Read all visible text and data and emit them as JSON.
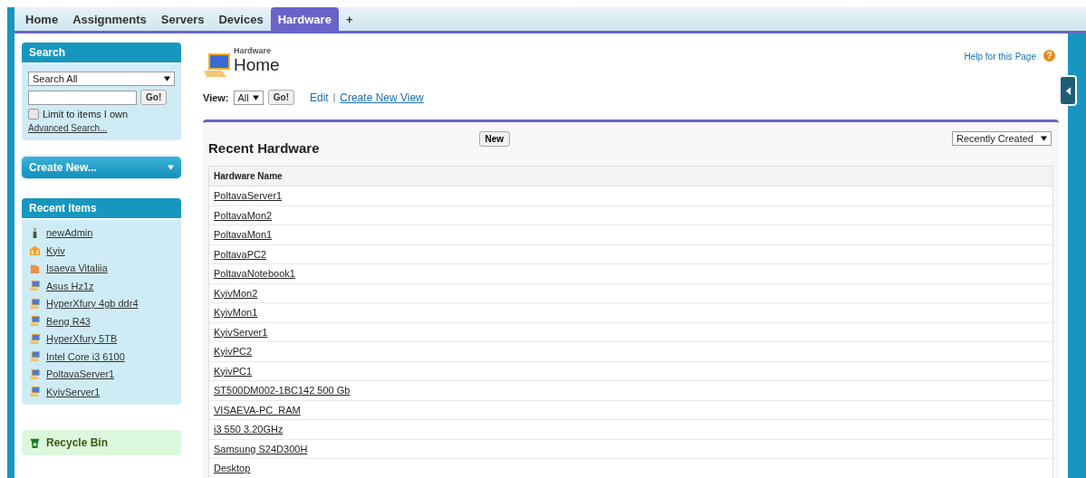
{
  "tabs": [
    {
      "label": "Home",
      "selected": false
    },
    {
      "label": "Assignments",
      "selected": false
    },
    {
      "label": "Servers",
      "selected": false
    },
    {
      "label": "Devices",
      "selected": false
    },
    {
      "label": "Hardware",
      "selected": true
    },
    {
      "label": "+",
      "selected": false
    }
  ],
  "sidebar": {
    "search": {
      "title": "Search",
      "scope": "Search All",
      "button": "Go!",
      "limit_label": "Limit to items I own",
      "limit_checked": false,
      "advanced": "Advanced Search..."
    },
    "create_new": "Create New...",
    "recent_items": {
      "title": "Recent Items",
      "items": [
        {
          "label": "newAdmin",
          "kind": "user"
        },
        {
          "label": "Kyiv",
          "kind": "building"
        },
        {
          "label": "Isaeva Vitaliia",
          "kind": "folder"
        },
        {
          "label": "Asus Hz1z",
          "kind": "computer"
        },
        {
          "label": "HyperXfury 4gb ddr4",
          "kind": "computer"
        },
        {
          "label": "Beng R43",
          "kind": "computer"
        },
        {
          "label": "HyperXfury 5TB",
          "kind": "computer"
        },
        {
          "label": "Intel Core i3 6100",
          "kind": "computer"
        },
        {
          "label": "PoltavaServer1",
          "kind": "computer"
        },
        {
          "label": "KyivServer1",
          "kind": "computer"
        }
      ]
    },
    "recycle_bin": "Recycle Bin"
  },
  "header": {
    "object": "Hardware",
    "title": "Home",
    "help": "Help for this Page",
    "help_icon": "?"
  },
  "view": {
    "label": "View:",
    "value": "All",
    "button": "Go!",
    "edit": "Edit",
    "separator": "|",
    "create": "Create New View"
  },
  "recent": {
    "title": "Recent Hardware",
    "new_button": "New",
    "sort": "Recently Created",
    "column": "Hardware Name",
    "rows": [
      "PoltavaServer1",
      "PoltavaMon2",
      "PoltavaMon1",
      "PoltavaPC2",
      "PoltavaNotebook1",
      "KyivMon2",
      "KyivMon1",
      "KyivServer1",
      "KyivPC2",
      "KyivPC1",
      "ST500DM002-1BC142 500 Gb",
      "VISAEVA-PC_RAM",
      "i3 550 3.20GHz",
      "Samsung S24D300H",
      "Desktop"
    ]
  }
}
